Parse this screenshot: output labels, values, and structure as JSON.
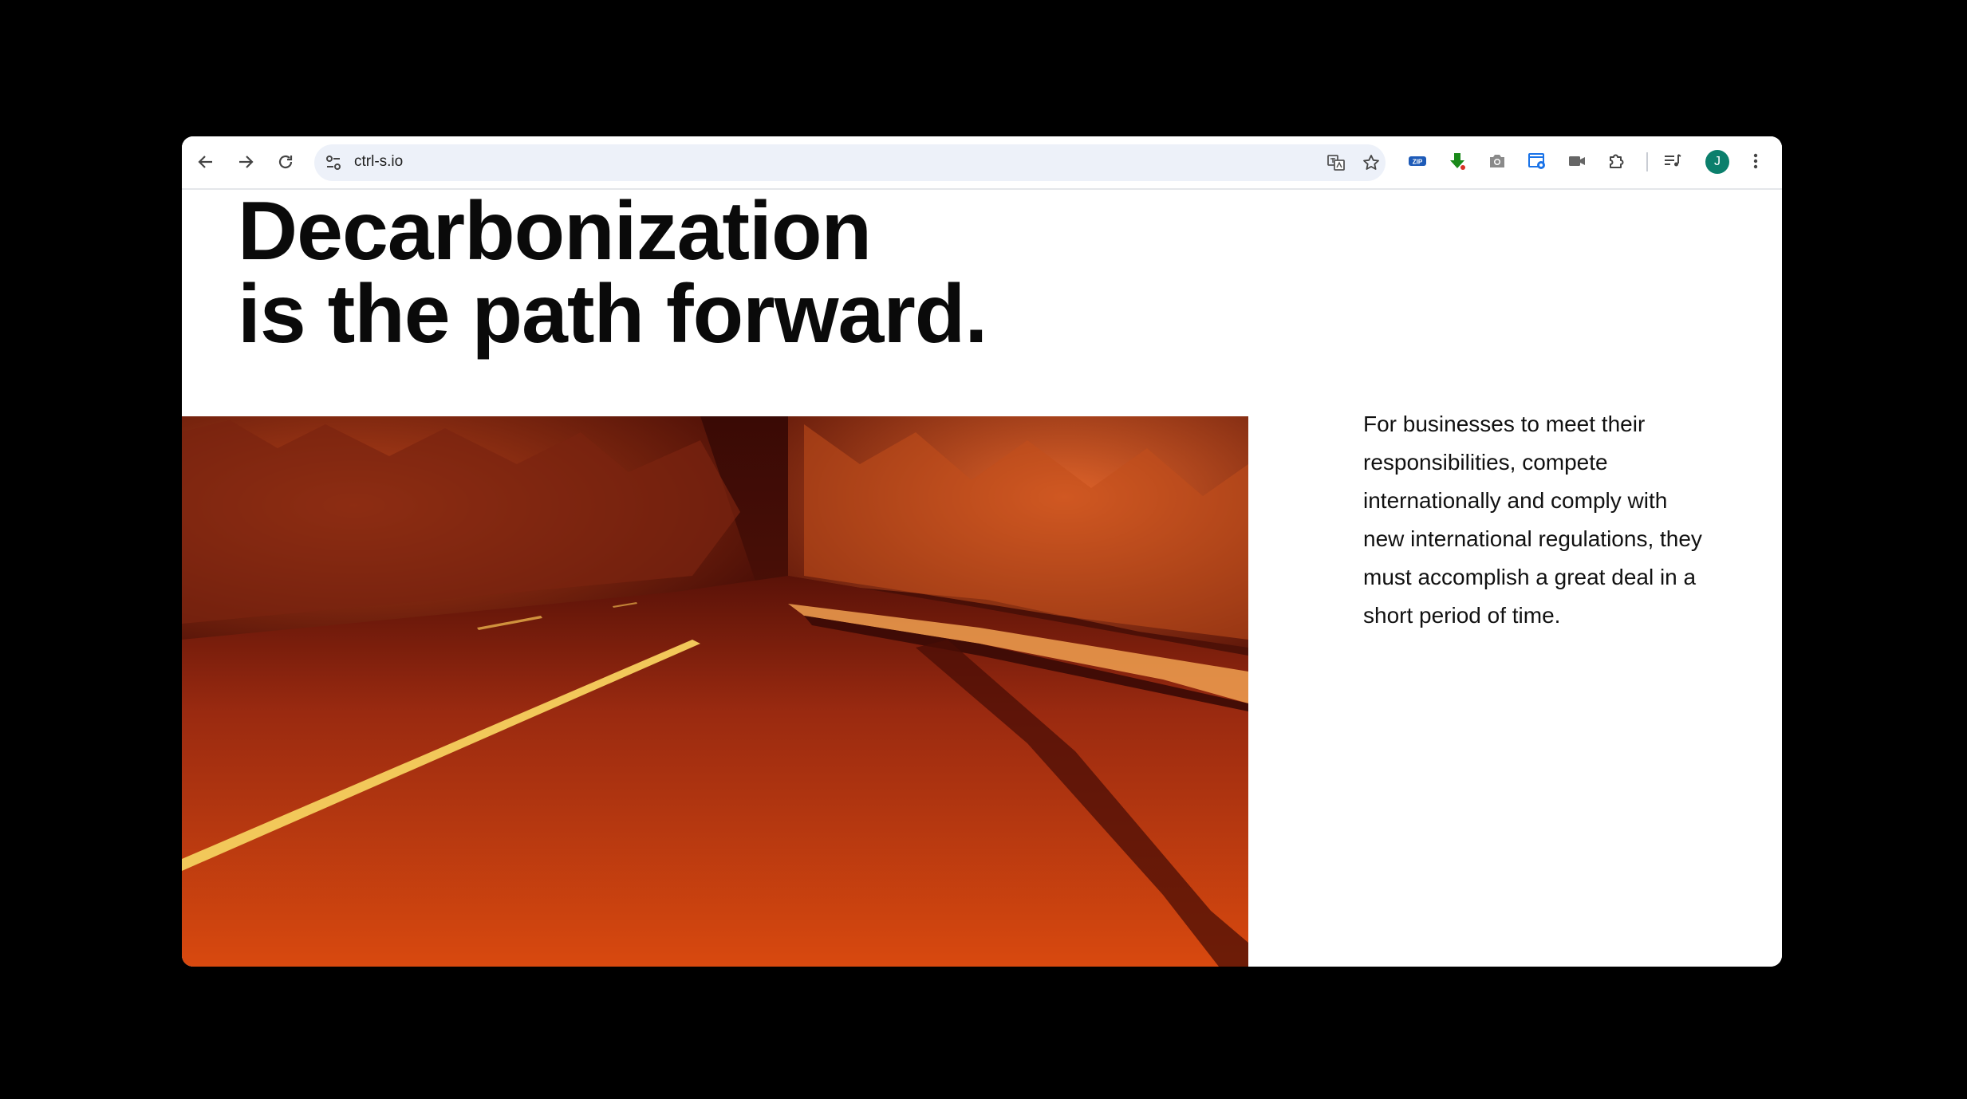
{
  "browser": {
    "url": "ctrl-s.io",
    "profile_initial": "J",
    "icons": {
      "back": "arrow-left-icon",
      "forward": "arrow-right-icon",
      "reload": "reload-icon",
      "site_info": "tune-icon",
      "translate": "translate-icon",
      "bookmark": "star-icon",
      "extensions": [
        "zip-extension-icon",
        "download-arrow-icon",
        "camera-icon",
        "screenshot-extension-icon",
        "video-camera-icon",
        "puzzle-icon",
        "reading-list-icon"
      ],
      "menu": "more-vert-icon"
    }
  },
  "page": {
    "headline_line1": "Decarbonization",
    "headline_line2": "is the path forward.",
    "paragraph": "For businesses to meet their responsibilities, compete internationally and comply with new international regulations, they must accomplish a great deal in a short period of time.",
    "photo_alt": "red-tinted-road-through-forest-image"
  },
  "colors": {
    "background": "#000000",
    "omnibox": "#edf1f9",
    "avatar": "#0b7f6c",
    "photo_tint": "#c2320d",
    "text": "#0a0a0a"
  }
}
